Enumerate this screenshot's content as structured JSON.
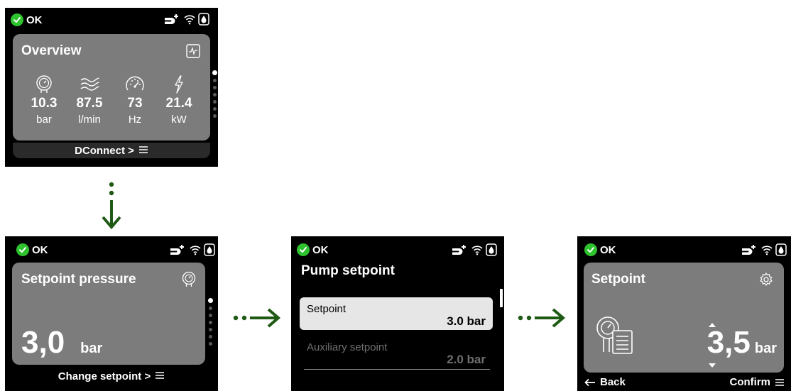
{
  "colors": {
    "ok_green": "#2ec22e",
    "card_gray": "#7c7c7c",
    "arrow_green": "#1f5a14",
    "selected_item": "#e6e6e6"
  },
  "status": {
    "label": "OK"
  },
  "overview": {
    "title": "Overview",
    "metrics": [
      {
        "icon": "pressure-gauge-icon",
        "value": "10.3",
        "unit": "bar"
      },
      {
        "icon": "flow-waves-icon",
        "value": "87.5",
        "unit": "l/min"
      },
      {
        "icon": "speedometer-icon",
        "value": "73",
        "unit": "Hz"
      },
      {
        "icon": "lightning-icon",
        "value": "21.4",
        "unit": "kW"
      }
    ],
    "footer": "DConnect >",
    "page_count": 7,
    "active_page": 1
  },
  "setpoint_pressure": {
    "title": "Setpoint pressure",
    "value": "3,0",
    "unit": "bar",
    "footer": "Change setpoint >",
    "page_count": 7,
    "active_page": 1
  },
  "pump_setpoint": {
    "title": "Pump setpoint",
    "items": [
      {
        "label": "Setpoint",
        "value": "3.0 bar",
        "selected": true
      },
      {
        "label": "Auxiliary setpoint",
        "value": "2.0 bar",
        "selected": false
      }
    ]
  },
  "setpoint_edit": {
    "title": "Setpoint",
    "value": "3,5",
    "unit": "bar",
    "back": "Back",
    "confirm": "Confirm"
  }
}
